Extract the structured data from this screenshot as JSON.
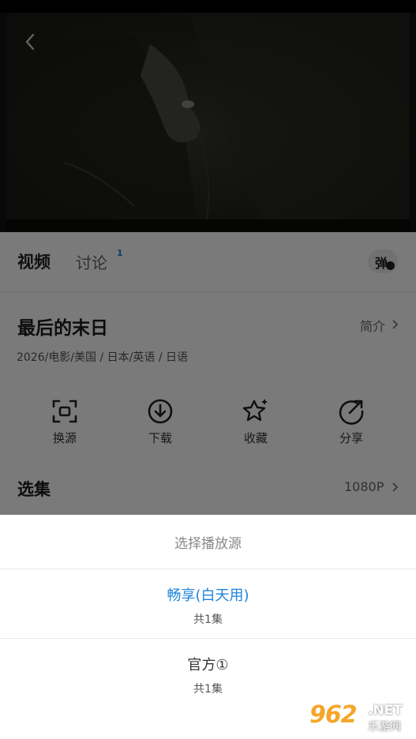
{
  "tabs": {
    "video": "视频",
    "discuss": "讨论",
    "discuss_badge": "1",
    "danmaku_label": "弹"
  },
  "movie": {
    "title": "最后的末日",
    "intro_label": "简介",
    "meta": "2026/电影/美国 / 日本/英语 / 日语"
  },
  "actions": [
    {
      "label": "换源",
      "icon": "switch-source-icon"
    },
    {
      "label": "下载",
      "icon": "download-icon"
    },
    {
      "label": "收藏",
      "icon": "star-icon"
    },
    {
      "label": "分享",
      "icon": "share-icon"
    }
  ],
  "episodes": {
    "title": "选集",
    "quality": "1080P"
  },
  "sheet": {
    "title": "选择播放源",
    "sources": [
      {
        "name": "畅享(白天用)",
        "count": "共1集",
        "selected": true
      },
      {
        "name": "官方①",
        "count": "共1集",
        "selected": false
      }
    ]
  },
  "watermark": {
    "logo": "962",
    "net": ".NET",
    "cn": "乐游网"
  },
  "colors": {
    "accent": "#1e84dc",
    "badge": "#1e7ddc",
    "overlay": "rgba(0,0,0,0.52)",
    "watermark": "#f4a62a"
  }
}
